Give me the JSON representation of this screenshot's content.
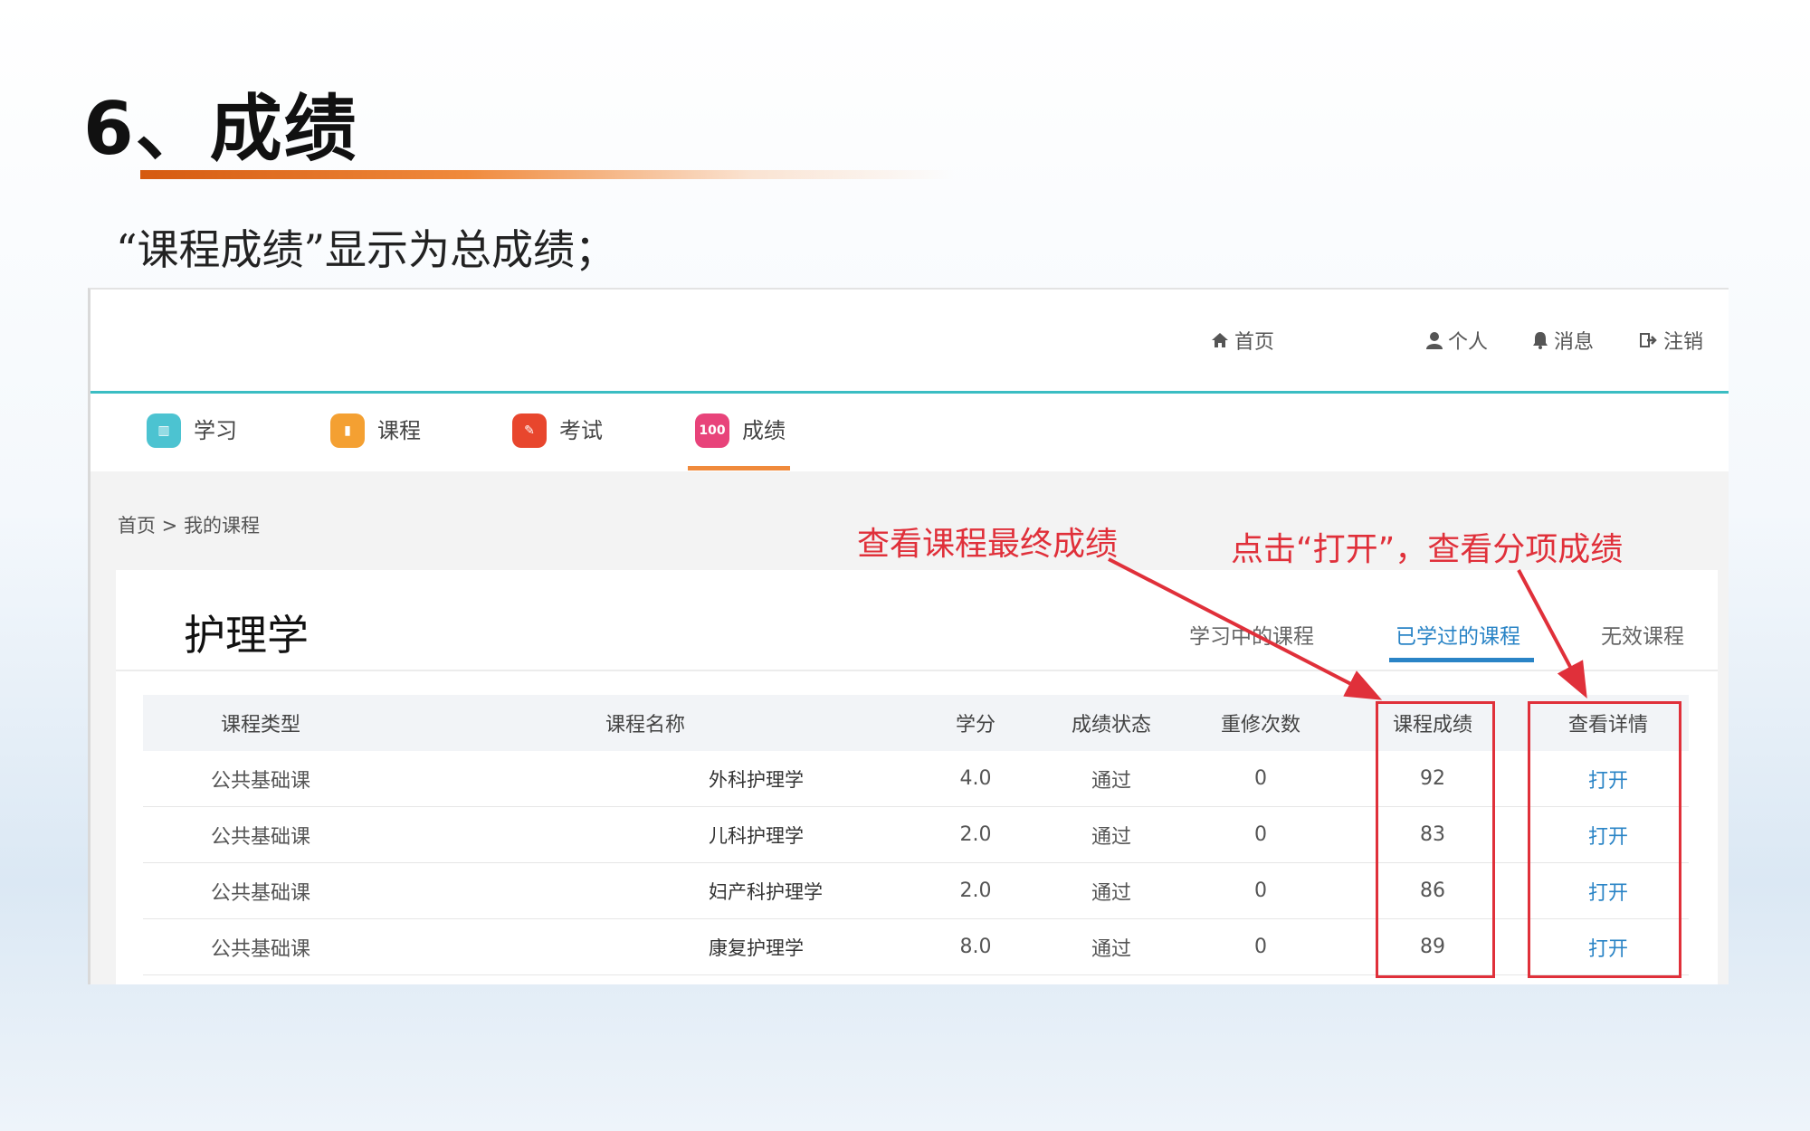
{
  "slide": {
    "title": "6、成绩",
    "subtitle": "“课程成绩”显示为总成绩；"
  },
  "header": {
    "home": "首页",
    "personal": "个人",
    "messages": "消息",
    "logout": "注销"
  },
  "nav": {
    "items": [
      {
        "label": "学习",
        "icon": "book-icon",
        "color": "#4cc3d1"
      },
      {
        "label": "课程",
        "icon": "folder-icon",
        "color": "#f4a032"
      },
      {
        "label": "考试",
        "icon": "pencil-icon",
        "color": "#e8462d"
      },
      {
        "label": "成绩",
        "icon": "score-100-icon",
        "color": "#e8437a"
      }
    ],
    "active_index": 3
  },
  "breadcrumb": "首页 > 我的课程",
  "major": {
    "title": "护理学"
  },
  "tabs": [
    {
      "label": "学习中的课程",
      "active": false
    },
    {
      "label": "已学过的课程",
      "active": true
    },
    {
      "label": "无效课程",
      "active": false
    }
  ],
  "table": {
    "headers": [
      "课程类型",
      "课程名称",
      "学分",
      "成绩状态",
      "重修次数",
      "课程成绩",
      "查看详情"
    ],
    "rows": [
      {
        "type": "公共基础课",
        "name": "外科护理学",
        "credit": "4.0",
        "status": "通过",
        "retakes": "0",
        "score": "92",
        "detail": "打开"
      },
      {
        "type": "公共基础课",
        "name": "儿科护理学",
        "credit": "2.0",
        "status": "通过",
        "retakes": "0",
        "score": "83",
        "detail": "打开"
      },
      {
        "type": "公共基础课",
        "name": "妇产科护理学",
        "credit": "2.0",
        "status": "通过",
        "retakes": "0",
        "score": "86",
        "detail": "打开"
      },
      {
        "type": "公共基础课",
        "name": "康复护理学",
        "credit": "8.0",
        "status": "通过",
        "retakes": "0",
        "score": "89",
        "detail": "打开"
      }
    ]
  },
  "annotations": {
    "final_score": "查看课程最终成绩",
    "open_detail": "点击“打开”，查看分项成绩",
    "color": "#e0303a"
  },
  "colors": {
    "accent_teal": "#3bbdc3",
    "accent_orange": "#f08a3c",
    "link_blue": "#2a84c6"
  }
}
